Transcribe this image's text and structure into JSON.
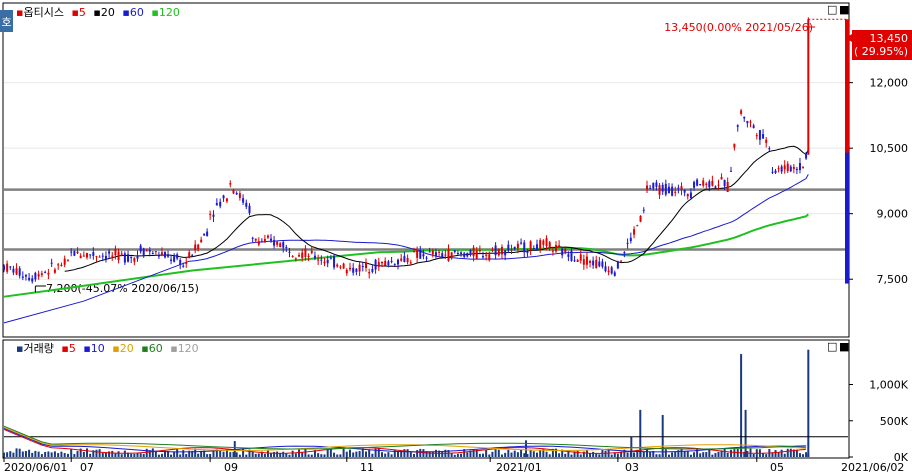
{
  "chart_data": [
    {
      "type": "candlestick",
      "name": "price",
      "legend_prefix": "▪",
      "title": "옵티시스",
      "ma_legend": [
        {
          "label": "5",
          "color": "#e00000"
        },
        {
          "label": "20",
          "color": "#000000"
        },
        {
          "label": "60",
          "color": "#1a1ad0"
        },
        {
          "label": "120",
          "color": "#20c020"
        }
      ],
      "y_ticks": [
        "12,000",
        "10,500",
        "9,000",
        "7,500"
      ],
      "y_tick_values": [
        12000,
        10500,
        9000,
        7500
      ],
      "ylim": [
        6200,
        13800
      ],
      "last_price_box": [
        "13,450",
        "( 29.95%)"
      ],
      "last_price": 13450,
      "high_annotation": "13,450(0.00% 2021/05/26)",
      "low_annotation": "7,200(-45.07% 2020/06/15)",
      "low_price": 7200,
      "horizontal_lines": [
        9550,
        8180
      ],
      "side_volume_profile": {
        "low": 7400,
        "high": 13450,
        "split": 10400
      },
      "ohlc_sampled": [
        {
          "d": "2020/06/01",
          "o": 7900,
          "h": 8150,
          "l": 7700,
          "c": 7800
        },
        {
          "d": "2020/06/15",
          "o": 7500,
          "h": 7700,
          "l": 7200,
          "c": 7600
        },
        {
          "d": "2020/07/01",
          "o": 7900,
          "h": 8200,
          "l": 7800,
          "c": 8100
        },
        {
          "d": "2020/08/01",
          "o": 8000,
          "h": 8300,
          "l": 7900,
          "c": 8200
        },
        {
          "d": "2020/08/20",
          "o": 7900,
          "h": 8100,
          "l": 7600,
          "c": 7800
        },
        {
          "d": "2020/09/01",
          "o": 8700,
          "h": 9200,
          "l": 8500,
          "c": 9000
        },
        {
          "d": "2020/09/10",
          "o": 9500,
          "h": 10300,
          "l": 9300,
          "c": 9700
        },
        {
          "d": "2020/09/20",
          "o": 9000,
          "h": 9200,
          "l": 8300,
          "c": 8400
        },
        {
          "d": "2020/10/05",
          "o": 8300,
          "h": 8500,
          "l": 8000,
          "c": 8200
        },
        {
          "d": "2020/11/01",
          "o": 7800,
          "h": 8000,
          "l": 7500,
          "c": 7700
        },
        {
          "d": "2020/12/01",
          "o": 8000,
          "h": 8200,
          "l": 7900,
          "c": 8050
        },
        {
          "d": "2021/01/05",
          "o": 8100,
          "h": 8300,
          "l": 8000,
          "c": 8150
        },
        {
          "d": "2021/02/01",
          "o": 8300,
          "h": 8800,
          "l": 8000,
          "c": 8200
        },
        {
          "d": "2021/03/02",
          "o": 7700,
          "h": 7900,
          "l": 7600,
          "c": 7800
        },
        {
          "d": "2021/03/15",
          "o": 9200,
          "h": 10000,
          "l": 9000,
          "c": 9600
        },
        {
          "d": "2021/04/05",
          "o": 9500,
          "h": 10000,
          "l": 9400,
          "c": 9700
        },
        {
          "d": "2021/04/20",
          "o": 9700,
          "h": 9800,
          "l": 9300,
          "c": 9600
        },
        {
          "d": "2021/04/26",
          "o": 11500,
          "h": 12000,
          "l": 10500,
          "c": 11300
        },
        {
          "d": "2021/05/10",
          "o": 10500,
          "h": 10800,
          "l": 9800,
          "c": 10000
        },
        {
          "d": "2021/05/25",
          "o": 10100,
          "h": 10400,
          "l": 9600,
          "c": 10350
        },
        {
          "d": "2021/05/26",
          "o": 10350,
          "h": 13450,
          "l": 10350,
          "c": 13450
        }
      ]
    },
    {
      "type": "bar",
      "name": "volume",
      "legend_prefix": "▪",
      "title": "거래량",
      "ma_legend": [
        {
          "label": "5",
          "color": "#e00000"
        },
        {
          "label": "10",
          "color": "#1a1ad0"
        },
        {
          "label": "20",
          "color": "#e0a000"
        },
        {
          "label": "60",
          "color": "#208020"
        },
        {
          "label": "120",
          "color": "#a0a0a0"
        }
      ],
      "y_ticks": [
        "1,000K",
        "500K",
        "0K"
      ],
      "y_tick_values": [
        1000000,
        500000,
        0
      ],
      "ylim": [
        0,
        1600000
      ],
      "reference_line": 280000,
      "spikes": [
        {
          "d": "2020/09/12",
          "v": 220000
        },
        {
          "d": "2021/01/20",
          "v": 230000
        },
        {
          "d": "2021/03/08",
          "v": 280000
        },
        {
          "d": "2021/03/12",
          "v": 650000
        },
        {
          "d": "2021/03/22",
          "v": 580000
        },
        {
          "d": "2021/04/26",
          "v": 1420000
        },
        {
          "d": "2021/04/28",
          "v": 650000
        },
        {
          "d": "2021/05/26",
          "v": 1480000
        }
      ]
    }
  ],
  "x_axis": {
    "labels": [
      "2020/06/01",
      "07",
      "09",
      "11",
      "2021/01",
      "03",
      "05"
    ],
    "end_label": "2021/06/02"
  },
  "window_buttons": {
    "restore": "□",
    "close": "■"
  },
  "corner_badge": "호"
}
